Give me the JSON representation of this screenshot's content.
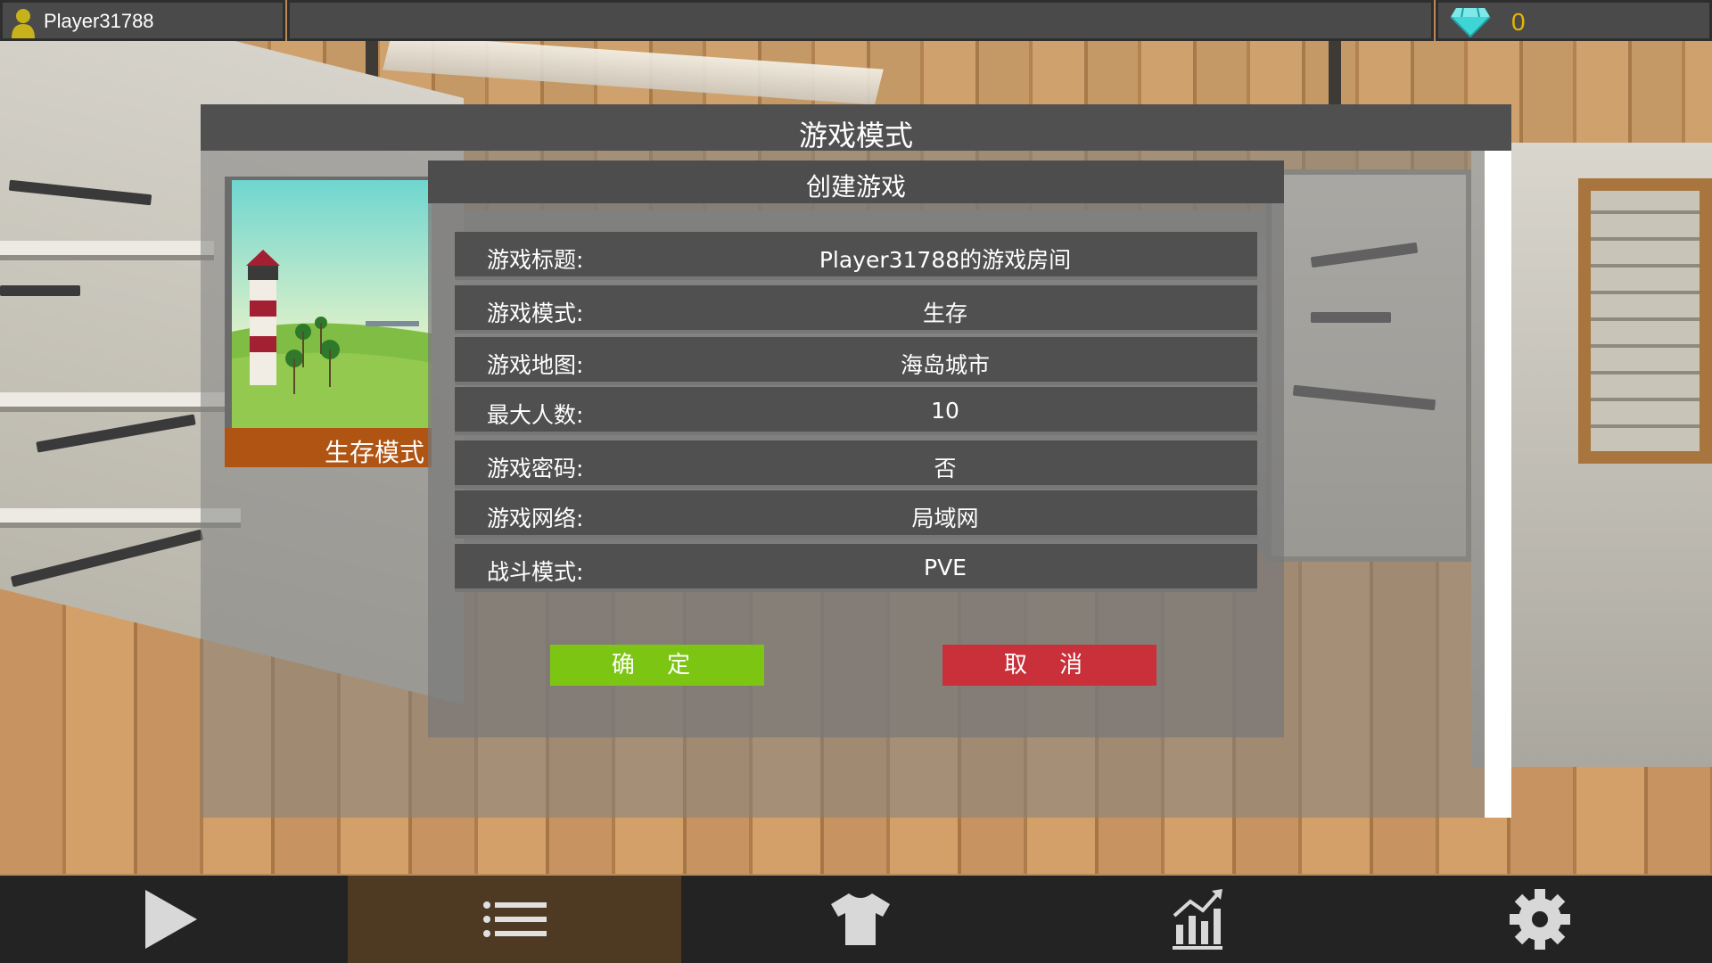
{
  "player": {
    "name": "Player31788"
  },
  "currency": {
    "gems": "0",
    "icon": "diamond-icon"
  },
  "modal": {
    "title": "游戏模式",
    "mode_card": {
      "caption": "生存模式"
    },
    "panel": {
      "title": "创建游戏",
      "rows": [
        {
          "label": "游戏标题:",
          "value": "Player31788的游戏房间"
        },
        {
          "label": "游戏模式:",
          "value": "生存"
        },
        {
          "label": "游戏地图:",
          "value": "海岛城市"
        },
        {
          "label": "最大人数:",
          "value": "10"
        },
        {
          "label": "游戏密码:",
          "value": "否"
        },
        {
          "label": "游戏网络:",
          "value": "局域网"
        },
        {
          "label": "战斗模式:",
          "value": "PVE"
        }
      ],
      "confirm_label": "确 定",
      "cancel_label": "取 消"
    }
  },
  "bottom_nav": {
    "items": [
      {
        "icon": "play-icon",
        "active": false
      },
      {
        "icon": "list-icon",
        "active": true
      },
      {
        "icon": "shirt-icon",
        "active": false
      },
      {
        "icon": "stats-icon",
        "active": false
      },
      {
        "icon": "gear-icon",
        "active": false
      }
    ]
  },
  "colors": {
    "confirm": "#7dc513",
    "cancel": "#c9303a",
    "gem_count": "#e8b400",
    "caption_bar": "#b05413",
    "nav_active": "#4e3a23"
  }
}
